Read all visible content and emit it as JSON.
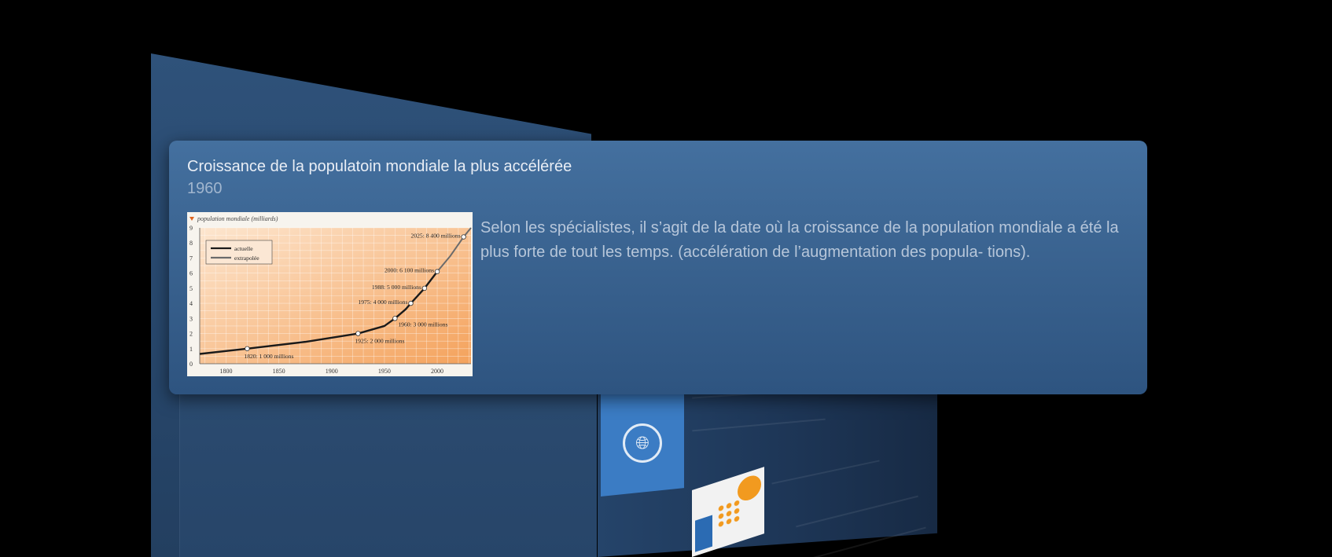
{
  "card": {
    "title": "Croissance de la populatoin mondiale la plus accélérée",
    "year": "1960",
    "description": "Selon les spécialistes, il s’agit de la date où la croissance de la population mondiale a été la plus forte de tout les temps. (accélération de l’augmentation des popula- tions)."
  },
  "chart_data": {
    "type": "line",
    "title": "population mondiale (milliards)",
    "xlabel": "",
    "ylabel": "",
    "xlim": [
      1775,
      2032
    ],
    "ylim": [
      0,
      9
    ],
    "x_ticks": [
      1800,
      1850,
      1900,
      1950,
      2000
    ],
    "y_ticks": [
      0,
      1,
      2,
      3,
      4,
      5,
      6,
      7,
      8,
      9
    ],
    "grid": true,
    "legend_position": "top-left",
    "series": [
      {
        "name": "actuelle",
        "color": "#1a1a1a",
        "x": [
          1775,
          1820,
          1875,
          1925,
          1950,
          1960,
          1970,
          1975,
          1988,
          2000
        ],
        "y": [
          0.65,
          1.0,
          1.45,
          2.0,
          2.5,
          3.0,
          3.6,
          4.0,
          5.0,
          6.1
        ]
      },
      {
        "name": "extrapolée",
        "color": "#6b6b6b",
        "x": [
          2000,
          2012,
          2025,
          2032
        ],
        "y": [
          6.1,
          7.1,
          8.4,
          9.0
        ]
      }
    ],
    "annotations": [
      {
        "x": 1820,
        "y": 1.0,
        "label": "1820: 1 000 millions",
        "anchor": "below"
      },
      {
        "x": 1925,
        "y": 2.0,
        "label": "1925: 2 000 millions",
        "anchor": "below"
      },
      {
        "x": 1960,
        "y": 3.0,
        "label": "1960: 3 000 millions",
        "anchor": "right"
      },
      {
        "x": 1975,
        "y": 4.0,
        "label": "1975: 4 000 millions",
        "anchor": "left"
      },
      {
        "x": 1988,
        "y": 5.0,
        "label": "1988: 5 000 millions",
        "anchor": "left"
      },
      {
        "x": 2000,
        "y": 6.1,
        "label": "2000: 6 100 millions",
        "anchor": "left"
      },
      {
        "x": 2025,
        "y": 8.4,
        "label": "2025: 8 400 millions",
        "anchor": "left"
      }
    ]
  },
  "colors": {
    "card_top": "#44709f",
    "card_bottom": "#2e5480",
    "chart_bg_light": "#fde6cf",
    "chart_bg_dark": "#f4a25c",
    "background": "#000000"
  },
  "icons": {
    "un_emblem": "un-emblem-icon"
  }
}
